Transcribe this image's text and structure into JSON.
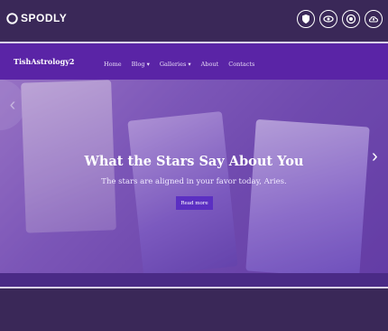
{
  "app": {
    "logo_text": "SPODLY"
  },
  "top_icons": [
    "shield-icon",
    "eye-icon",
    "badge-icon",
    "cloud-upload-icon"
  ],
  "site": {
    "brand": "TishAstrology2"
  },
  "nav": {
    "items": [
      {
        "label": "Home"
      },
      {
        "label": "Blog ▾"
      },
      {
        "label": "Galleries ▾"
      },
      {
        "label": "About"
      },
      {
        "label": "Contacts"
      }
    ]
  },
  "hero": {
    "title": "What the Stars Say About You",
    "subtitle": "The stars are aligned in your favor today, Aries.",
    "button_label": "Read more",
    "prev_arrow": "‹",
    "next_arrow": "›"
  },
  "colors": {
    "topbar": "#3a2858",
    "nav": "#5a24a6",
    "button": "#5b2fc2"
  }
}
